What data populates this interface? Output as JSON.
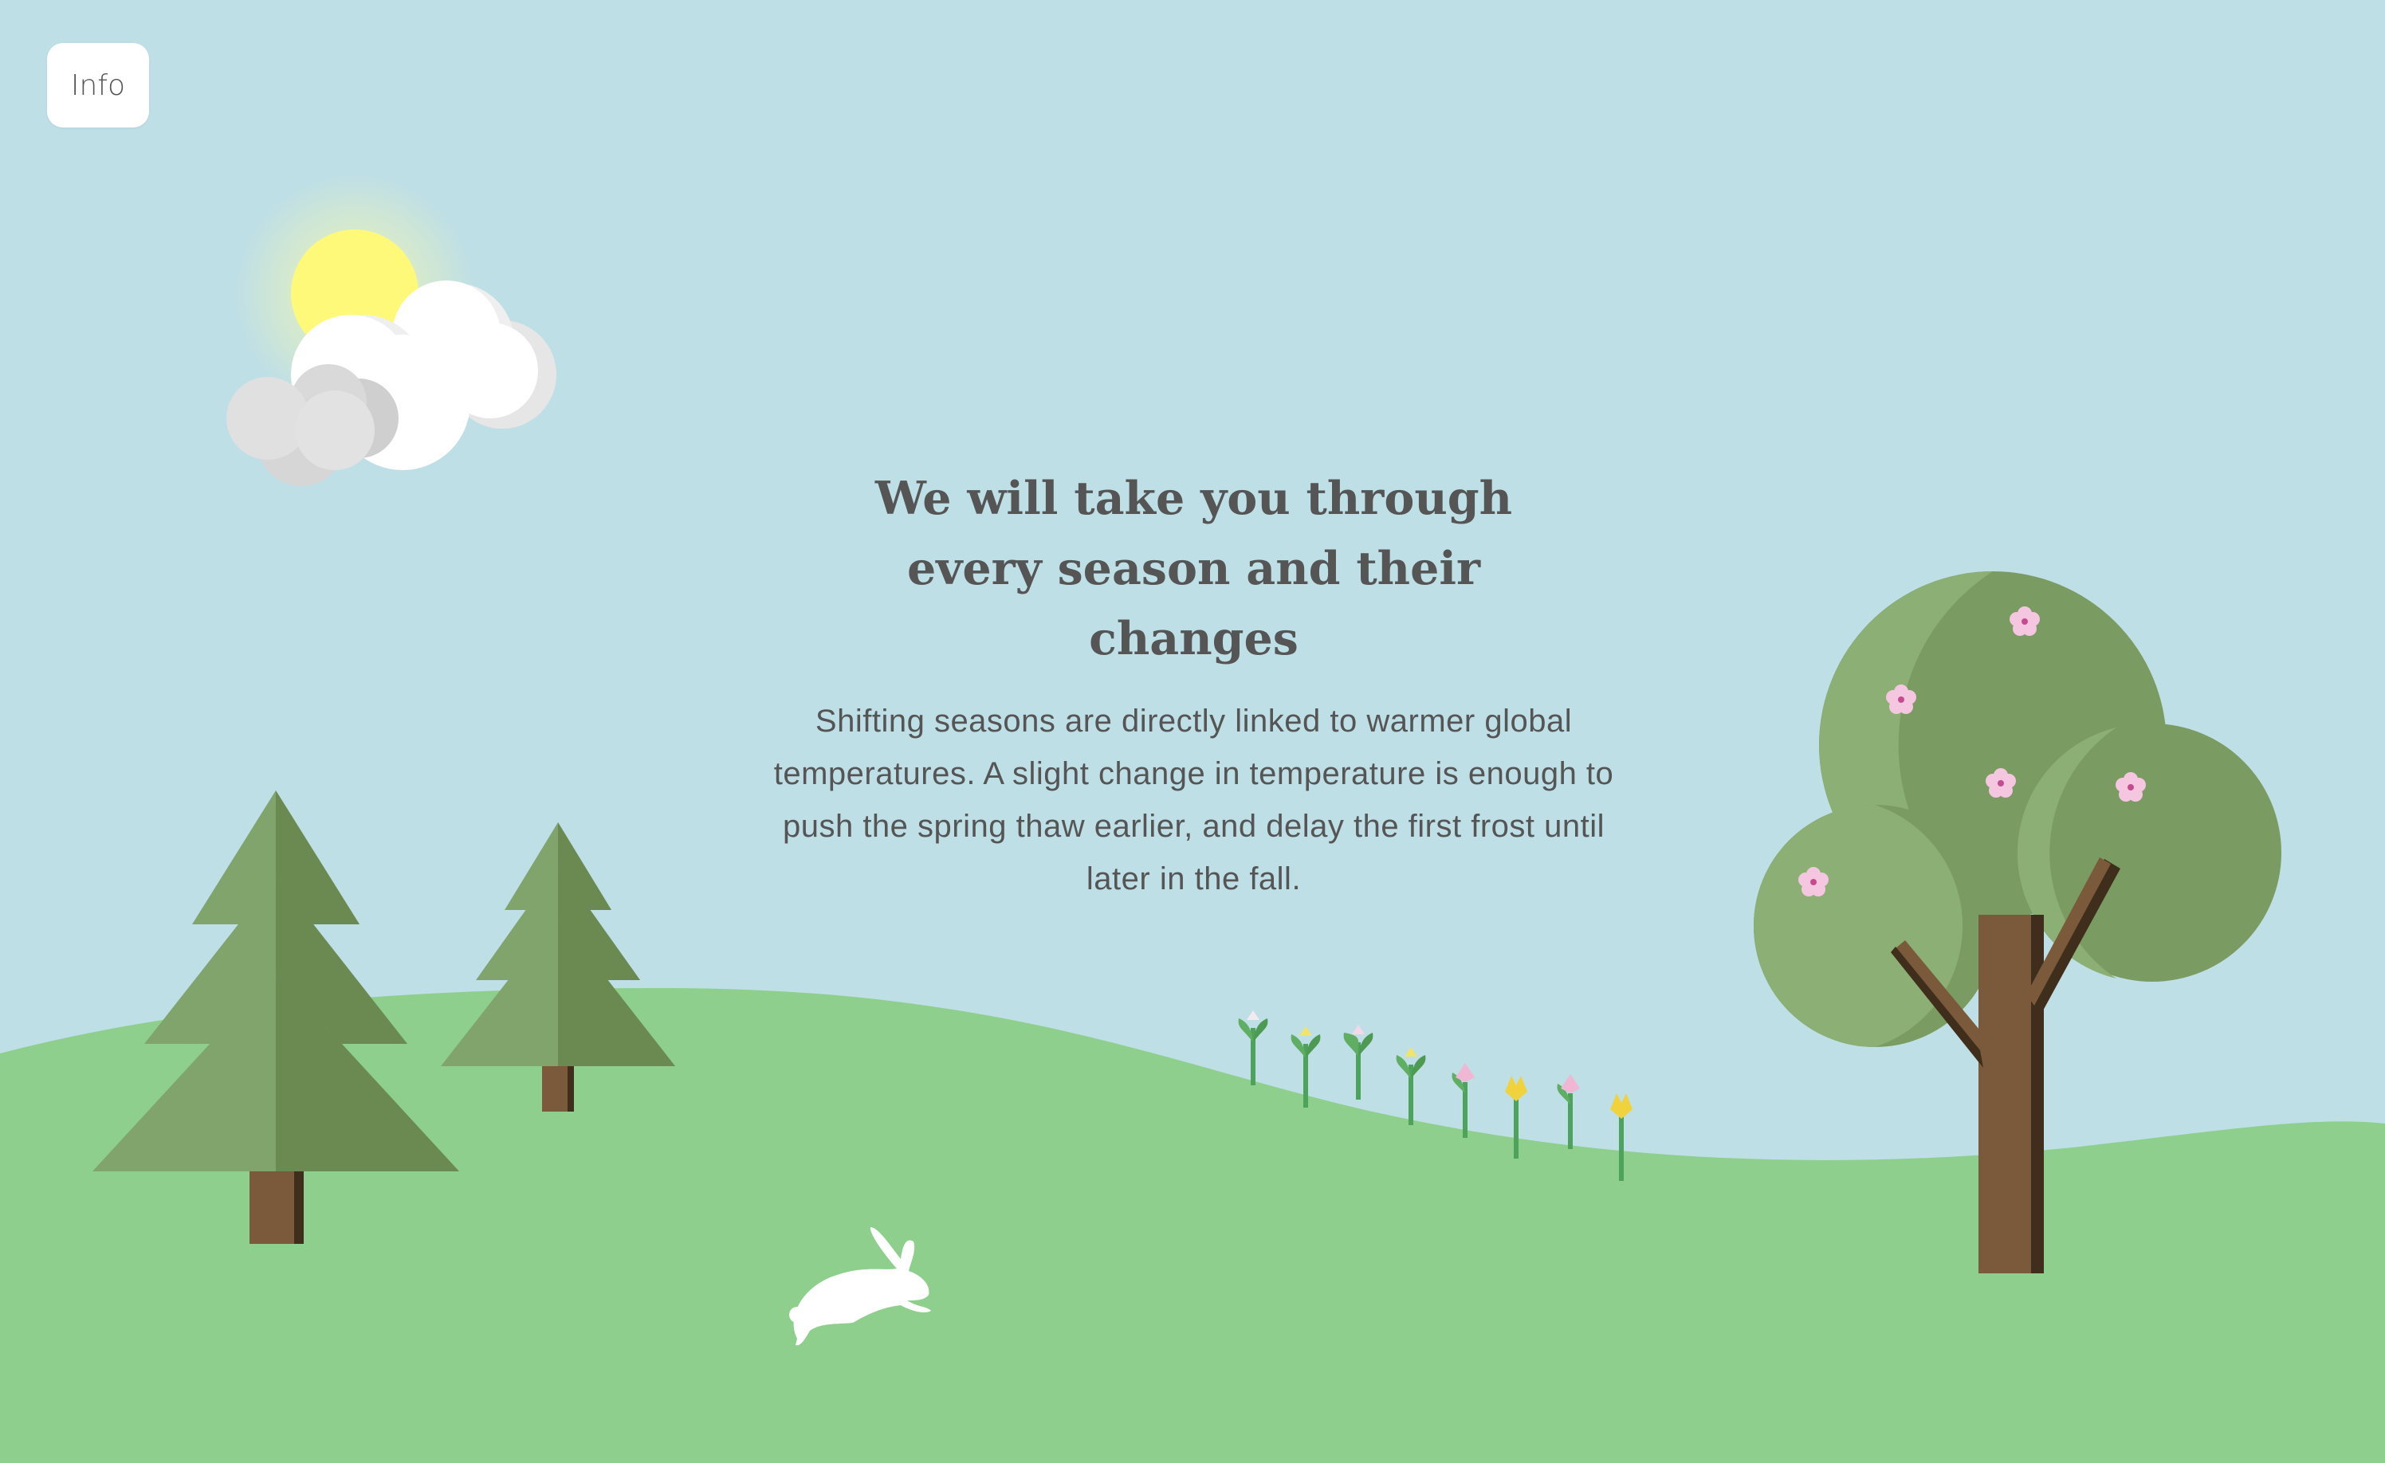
{
  "page": {
    "info_button_label": "Info",
    "headline": "We will take you through every season and their changes",
    "body": "Shifting seasons are directly linked to warmer global temperatures. A slight change in temperature is enough to push the spring thaw earlier, and delay the first frost until later in the fall."
  },
  "scene": {
    "season": "spring",
    "icons": [
      "sun-icon",
      "cloud-icon",
      "pine-tree-icon",
      "blossom-tree-icon",
      "flower-icon",
      "rabbit-icon"
    ],
    "colors": {
      "sky": "#bfdfe6",
      "grass": "#8fcf8d",
      "pine_light": "#80a46b",
      "pine_dark": "#6a8a52",
      "trunk": "#7a5a3a",
      "trunk_shadow": "#3f2e1c",
      "canopy_light": "#8baf74",
      "canopy_dark": "#7a9c62",
      "sun": "#fff97a",
      "cloud_white": "#ffffff",
      "cloud_grey": "#dcdcdc",
      "blossom": "#f5c6e0",
      "text": "#555555"
    }
  }
}
